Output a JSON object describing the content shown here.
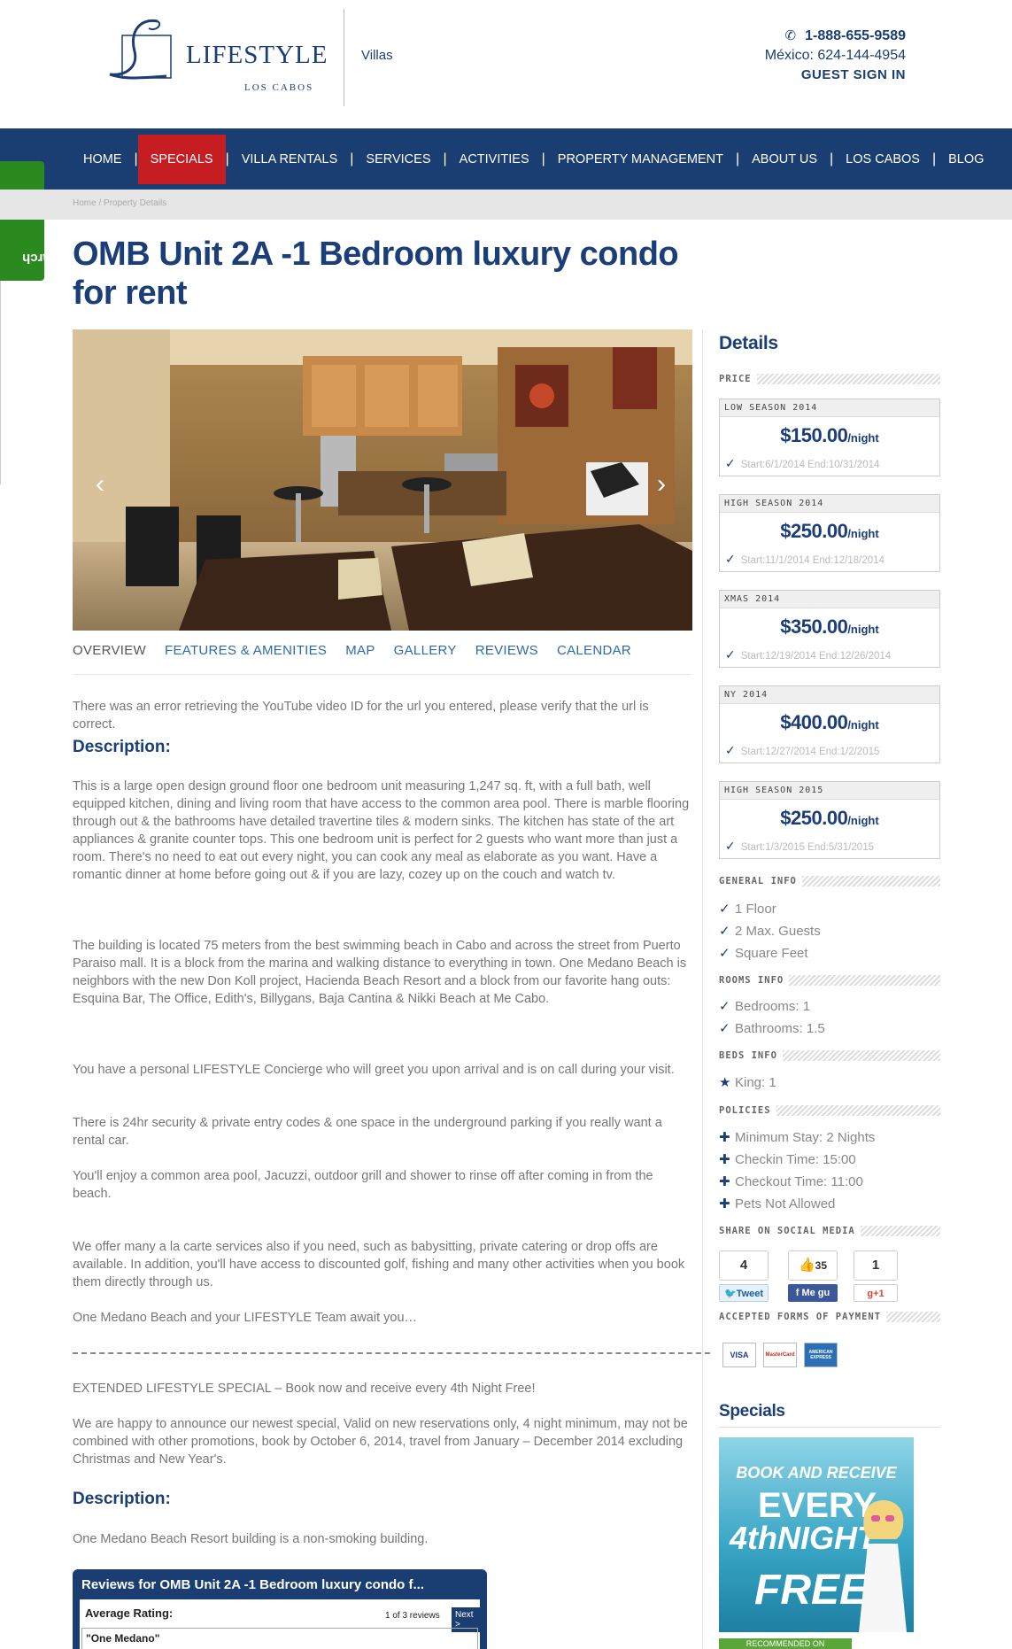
{
  "header": {
    "logo_text": "LIFESTYLE",
    "logo_sub": "LOS CABOS",
    "section": "Villas",
    "phone": "1-888-655-9589",
    "mexico": "México: 624-144-4954",
    "guest_sign_in": "GUEST SIGN IN"
  },
  "nav": {
    "items": [
      "HOME",
      "SPECIALS",
      "VILLA RENTALS",
      "SERVICES",
      "ACTIVITIES",
      "PROPERTY MANAGEMENT",
      "ABOUT US",
      "LOS CABOS",
      "BLOG"
    ],
    "separator": "|"
  },
  "villa_search": "Villa Search",
  "breadcrumb": {
    "home": "Home",
    "sep": "/",
    "current": "Property Details"
  },
  "page_title": "OMB Unit 2A -1 Bedroom luxury condo for rent",
  "tabs": [
    "OVERVIEW",
    "FEATURES & AMENITIES",
    "MAP",
    "GALLERY",
    "REVIEWS",
    "CALENDAR"
  ],
  "overview": {
    "youtube_error": "There was an error retrieving the YouTube video ID for the url you entered, please verify that the url is correct.",
    "description_heading": "Description:",
    "p1": "This is a large open design ground floor one bedroom unit measuring 1,247 sq. ft, with a full bath, well equipped kitchen, dining and living room that have access to the common area pool. There is marble flooring through out & the bathrooms have detailed travertine tiles & modern sinks. The kitchen has state of the art appliances & granite counter tops. This one bedroom unit is perfect for 2 guests who want more than just a room. There's no need to eat out every night, you can cook any meal as elaborate as you want. Have a romantic dinner at home before going out & if you are lazy, cozey up on the couch and watch tv.",
    "p2": "The building is located 75 meters from the best swimming beach in Cabo and across the street from Puerto Paraiso mall. It is a block from the marina and walking distance to everything in town. One Medano Beach is neighbors with the new Don Koll project, Hacienda Beach Resort and a block from our favorite hang outs: Esquina Bar, The Office, Edith's, Billygans, Baja Cantina & Nikki Beach at Me Cabo.",
    "p3": "You have a personal LIFESTYLE Concierge who will greet you upon arrival and is on call during your visit.",
    "p4": "There is 24hr security & private entry codes & one space in the underground parking if you really want a rental car.",
    "p5": "You'll enjoy a common area pool, Jacuzzi, outdoor grill and shower to rinse off after coming in from the beach.",
    "p6": "We offer many a la carte services also if you need, such as babysitting, private catering or drop offs are available. In addition, you'll have access to discounted golf, fishing and many other activities when you book them directly through us.",
    "p7": "One Medano Beach and your LIFESTYLE Team await you…",
    "special_title": "EXTENDED LIFESTYLE SPECIAL – Book now and receive every 4th Night Free!",
    "special_text": "We are happy to announce our newest special, Valid on new reservations only, 4 night minimum, may not be combined with other promotions, book by October 6, 2014, travel from January – December 2014 excluding Christmas and New Year's.",
    "description_heading2": "Description:",
    "non_smoking": "One Medano Beach Resort building is a non-smoking building."
  },
  "reviews_widget": {
    "title": "Reviews for OMB Unit 2A -1 Bedroom luxury condo f...",
    "avg_label": "Average Rating:",
    "count": "1 of 3 reviews",
    "next": "Next >",
    "quote": "\"One Medano\""
  },
  "sidebar": {
    "details_heading": "Details",
    "price_label": "PRICE",
    "prices": [
      {
        "season": "LOW SEASON 2014",
        "amount": "$150.00",
        "unit": "/night",
        "dates": "Start:6/1/2014 End:10/31/2014"
      },
      {
        "season": "HIGH SEASON 2014",
        "amount": "$250.00",
        "unit": "/night",
        "dates": "Start:11/1/2014 End:12/18/2014"
      },
      {
        "season": "XMAS 2014",
        "amount": "$350.00",
        "unit": "/night",
        "dates": "Start:12/19/2014 End:12/26/2014"
      },
      {
        "season": "NY 2014",
        "amount": "$400.00",
        "unit": "/night",
        "dates": "Start:12/27/2014 End:1/2/2015"
      },
      {
        "season": "HIGH SEASON 2015",
        "amount": "$250.00",
        "unit": "/night",
        "dates": "Start:1/3/2015 End:5/31/2015"
      }
    ],
    "general_label": "GENERAL INFO",
    "general": [
      "1 Floor",
      "2 Max. Guests",
      "Square Feet"
    ],
    "rooms_label": "ROOMS INFO",
    "rooms": [
      "Bedrooms: 1",
      "Bathrooms: 1.5"
    ],
    "beds_label": "BEDS INFO",
    "beds": [
      "King: 1"
    ],
    "policies_label": "POLICIES",
    "policies": [
      "Minimum Stay: 2 Nights",
      "Checkin Time: 15:00",
      "Checkout Time: 11:00",
      "Pets Not Allowed"
    ],
    "share_label": "SHARE ON SOCIAL MEDIA",
    "share": {
      "tweet_count": "4",
      "tweet_label": "Tweet",
      "fb_count": "35",
      "fb_label": "Me gu",
      "gplus_count": "1",
      "gplus_label": "g+1"
    },
    "payment_label": "ACCEPTED FORMS OF PAYMENT",
    "payment": [
      "VISA",
      "MasterCard",
      "AMERICAN EXPRESS"
    ],
    "specials_heading": "Specials",
    "specials_banner": {
      "line1": "BOOK AND RECEIVE",
      "line2": "EVERY",
      "line3": "4thNIGHT",
      "line4": "FREE"
    },
    "recommended": "RECOMMENDED ON"
  },
  "colors": {
    "brand_blue": "#1a3d72",
    "specials_red": "#c61d23",
    "villa_green": "#2b8a1f"
  },
  "icons": {
    "phone": "phone-icon",
    "search": "search-icon",
    "check": "check-icon",
    "star": "star-icon",
    "plus": "plus-icon"
  }
}
